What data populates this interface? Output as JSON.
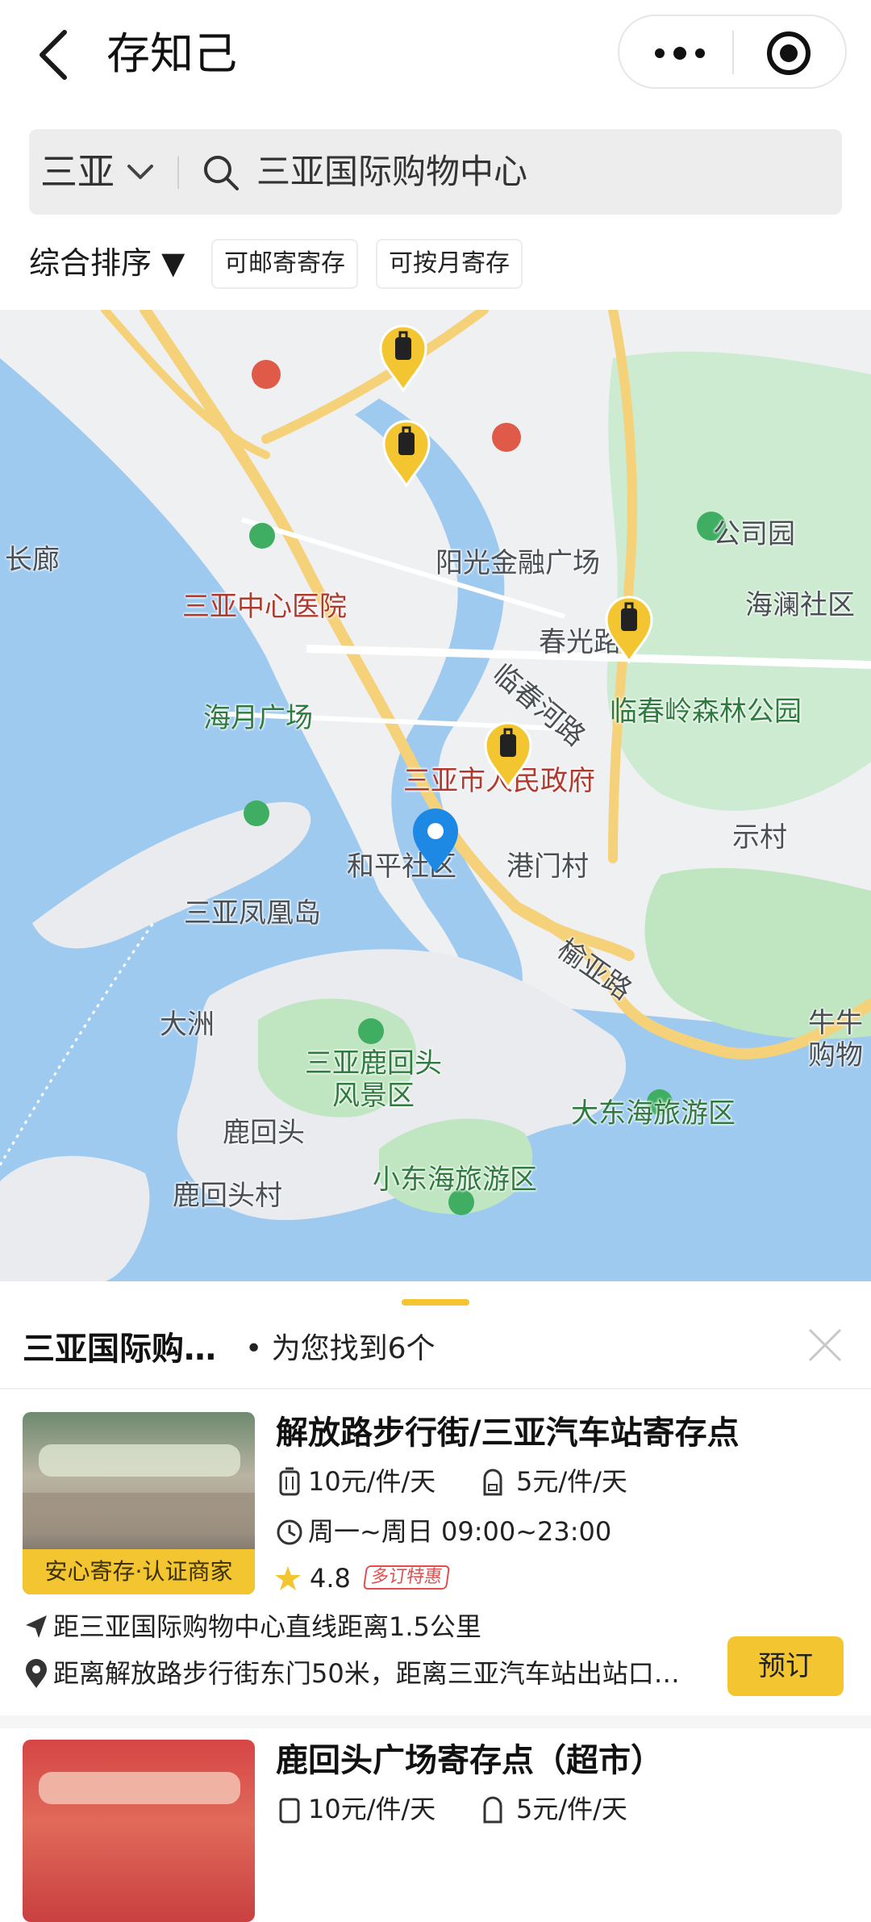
{
  "header": {
    "title": "存知己"
  },
  "search": {
    "city": "三亚",
    "query": "三亚国际购物中心"
  },
  "filters": {
    "sort_label": "综合排序 ▼",
    "chips": [
      "可邮寄寄存",
      "可按月寄存"
    ]
  },
  "map": {
    "labels": {
      "changlang": "长廊",
      "sanya_hospital": "三亚中心医院",
      "yangguang": "阳光金融广场",
      "gongsiyuan": "公司园",
      "hailan": "海澜社区",
      "chunguang": "春光路",
      "haiyue": "海月广场",
      "linchunhe": "临春河路",
      "linchunling": "临春岭森林公园",
      "gov": "三亚市人民政府",
      "shicun": "示村",
      "heping": "和平社区",
      "gangmen": "港门村",
      "fenghuang": "三亚凤凰岛",
      "yuya": "榆亚路",
      "niuniu": "牛牛购物",
      "dazhou": "大洲",
      "luhuitou_scenic": "三亚鹿回头风景区",
      "dadonghai": "大东海旅游区",
      "luhuitou": "鹿回头",
      "xiaodonghai": "小东海旅游区",
      "luhuitou_village": "鹿回头村"
    }
  },
  "sheet": {
    "title": "三亚国际购…",
    "count_text": "• 为您找到6个",
    "cards": [
      {
        "name": "解放路步行街/三亚汽车站寄存点",
        "price_large": "10元/件/天",
        "price_small": "5元/件/天",
        "hours": "周一~周日 09:00~23:00",
        "rating": "4.8",
        "promo": "多订特惠",
        "badge": "安心寄存·认证商家",
        "distance": "距三亚国际购物中心直线距离1.5公里",
        "address": "距离解放路步行街东门50米，距离三亚汽车站出站口…",
        "book_label": "预订"
      },
      {
        "name": "鹿回头广场寄存点（超市）",
        "price_large": "10元/件/天",
        "price_small": "5元/件/天"
      }
    ]
  },
  "colors": {
    "accent": "#f2c531",
    "water": "#9fcaf0",
    "park": "#bfe5c1",
    "road": "#f5d27a"
  }
}
